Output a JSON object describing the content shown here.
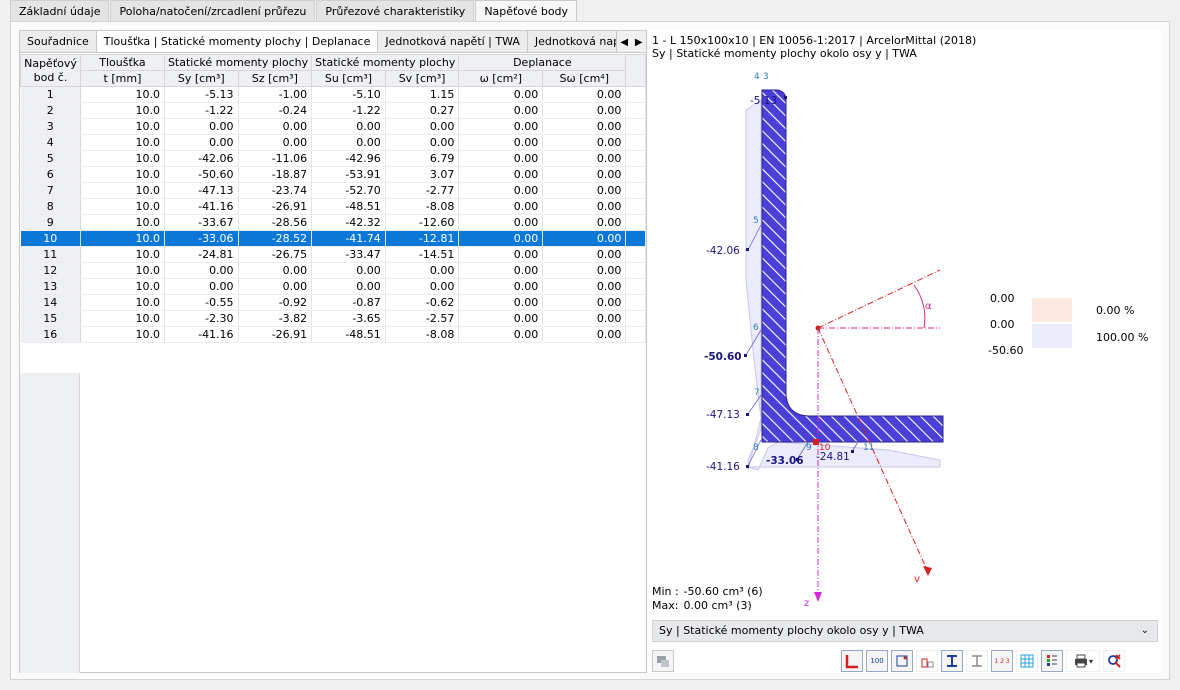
{
  "top_tabs": [
    "Základní údaje",
    "Poloha/natočení/zrcadlení průřezu",
    "Průřezové charakteristiky",
    "Napěťové body"
  ],
  "sub_tabs": [
    "Souřadnice",
    "Tloušťka | Statické momenty plochy | Deplanace",
    "Jednotková napětí | TWA",
    "Jednotková napětí |"
  ],
  "table": {
    "group_headers": {
      "point": "Napěťový bod č.",
      "thickness": "Tloušťka",
      "static1": "Statické momenty plochy",
      "static2": "Statické momenty plochy",
      "warping": "Deplanace"
    },
    "sub_headers": [
      "t [mm]",
      "Sy [cm³]",
      "Sz [cm³]",
      "Su [cm³]",
      "Sv [cm³]",
      "ω [cm²]",
      "Sω [cm⁴]"
    ],
    "rows": [
      [
        "1",
        "10.0",
        "-5.13",
        "-1.00",
        "-5.10",
        "1.15",
        "0.00",
        "0.00"
      ],
      [
        "2",
        "10.0",
        "-1.22",
        "-0.24",
        "-1.22",
        "0.27",
        "0.00",
        "0.00"
      ],
      [
        "3",
        "10.0",
        "0.00",
        "0.00",
        "0.00",
        "0.00",
        "0.00",
        "0.00"
      ],
      [
        "4",
        "10.0",
        "0.00",
        "0.00",
        "0.00",
        "0.00",
        "0.00",
        "0.00"
      ],
      [
        "5",
        "10.0",
        "-42.06",
        "-11.06",
        "-42.96",
        "6.79",
        "0.00",
        "0.00"
      ],
      [
        "6",
        "10.0",
        "-50.60",
        "-18.87",
        "-53.91",
        "3.07",
        "0.00",
        "0.00"
      ],
      [
        "7",
        "10.0",
        "-47.13",
        "-23.74",
        "-52.70",
        "-2.77",
        "0.00",
        "0.00"
      ],
      [
        "8",
        "10.0",
        "-41.16",
        "-26.91",
        "-48.51",
        "-8.08",
        "0.00",
        "0.00"
      ],
      [
        "9",
        "10.0",
        "-33.67",
        "-28.56",
        "-42.32",
        "-12.60",
        "0.00",
        "0.00"
      ],
      [
        "10",
        "10.0",
        "-33.06",
        "-28.52",
        "-41.74",
        "-12.81",
        "0.00",
        "0.00"
      ],
      [
        "11",
        "10.0",
        "-24.81",
        "-26.75",
        "-33.47",
        "-14.51",
        "0.00",
        "0.00"
      ],
      [
        "12",
        "10.0",
        "0.00",
        "0.00",
        "0.00",
        "0.00",
        "0.00",
        "0.00"
      ],
      [
        "13",
        "10.0",
        "0.00",
        "0.00",
        "0.00",
        "0.00",
        "0.00",
        "0.00"
      ],
      [
        "14",
        "10.0",
        "-0.55",
        "-0.92",
        "-0.87",
        "-0.62",
        "0.00",
        "0.00"
      ],
      [
        "15",
        "10.0",
        "-2.30",
        "-3.82",
        "-3.65",
        "-2.57",
        "0.00",
        "0.00"
      ],
      [
        "16",
        "10.0",
        "-41.16",
        "-26.91",
        "-48.51",
        "-8.08",
        "0.00",
        "0.00"
      ]
    ],
    "selected_row": 10
  },
  "diagram": {
    "title_line1": "1 - L 150x100x10 | EN 10056-1:2017 | ArcelorMittal (2018)",
    "title_line2": "Sy | Statické momenty plochy okolo osy y | TWA",
    "point_numbers": [
      "4",
      "3",
      "5",
      "6",
      "7",
      "8",
      "9",
      "10",
      "11"
    ],
    "value_labels": [
      "-5.13",
      "-42.06",
      "-50.60",
      "-47.13",
      "-41.16",
      "-33.06",
      "-24.81"
    ],
    "axis_labels": {
      "alpha": "α",
      "v": "v",
      "z": "z"
    },
    "legend": [
      {
        "value": "0.00",
        "color": "#fde8e2"
      },
      {
        "value": "0.00",
        "percent": "0.00 %",
        "color": "#ecebfb"
      },
      {
        "value": "-50.60",
        "percent": "100.00 %"
      }
    ],
    "min_label": "Min :",
    "min_value": "-50.60 cm³ (6)",
    "max_label": "Max:",
    "max_value": "0.00 cm³ (3)",
    "hatch_color": "#4a3fd6",
    "accent": "#0b78d7"
  },
  "dropdown": "Sy | Statické momenty plochy okolo osy y | TWA",
  "toolbar": {
    "values_icon_label": "100",
    "numbering_icon_label": "1 2 3"
  }
}
